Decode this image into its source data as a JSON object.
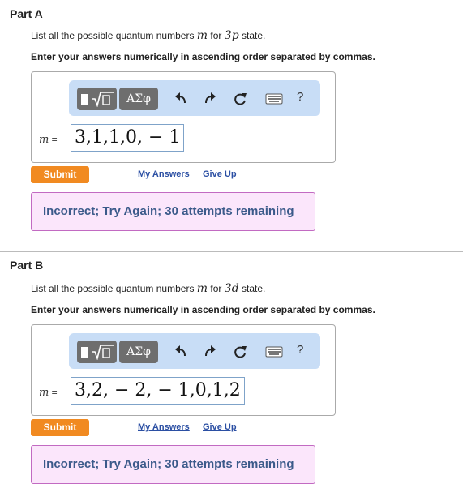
{
  "part_a": {
    "title": "Part A",
    "question_prefix": "List all the possible quantum numbers",
    "question_var": "m",
    "question_mid": "for",
    "question_state": "3p",
    "question_suffix": "state.",
    "instruction": "Enter your answers numerically in ascending order separated by commas.",
    "toolbar": {
      "greek_label": "ΑΣφ",
      "help_label": "?"
    },
    "var_label": "m",
    "equals": "=",
    "answer_value": "3,1,1,0, − 1",
    "submit_label": "Submit",
    "my_answers_label": "My Answers",
    "give_up_label": "Give Up",
    "feedback": "Incorrect; Try Again; 30 attempts remaining"
  },
  "part_b": {
    "title": "Part B",
    "question_prefix": "List all the possible quantum numbers",
    "question_var": "m",
    "question_mid": "for",
    "question_state": "3d",
    "question_suffix": "state.",
    "instruction": "Enter your answers numerically in ascending order separated by commas.",
    "toolbar": {
      "greek_label": "ΑΣφ",
      "help_label": "?"
    },
    "var_label": "m",
    "equals": "=",
    "answer_value": "3,2, − 2, − 1,0,1,2",
    "submit_label": "Submit",
    "my_answers_label": "My Answers",
    "give_up_label": "Give Up",
    "feedback": "Incorrect; Try Again; 30 attempts remaining"
  },
  "colors": {
    "submit": "#f18a21",
    "toolbar_bg": "#c8ddf6",
    "feedback_bg": "#fbe6fb",
    "feedback_border": "#c26ac2",
    "feedback_text": "#3b5a8a",
    "link": "#2b4fa3"
  }
}
